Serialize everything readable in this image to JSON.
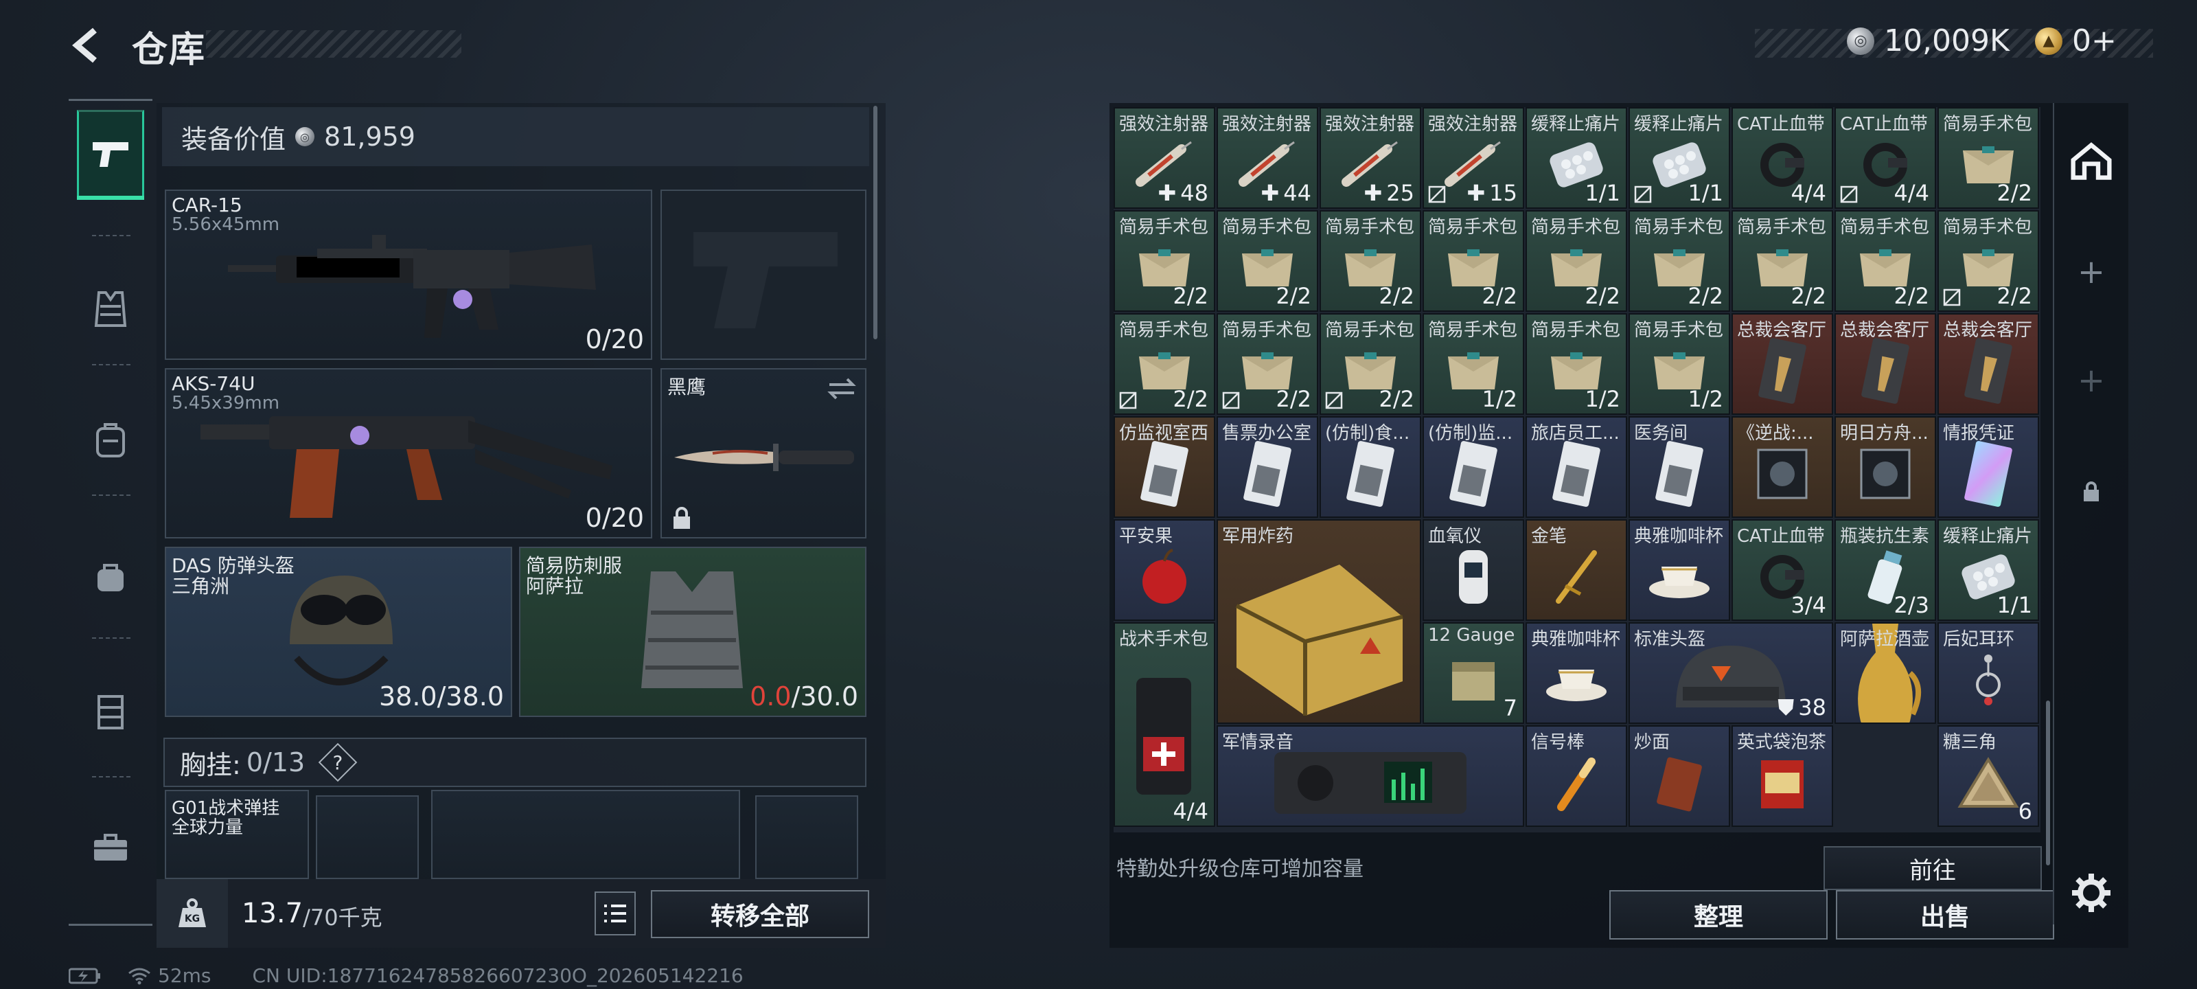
{
  "header": {
    "title": "仓库"
  },
  "currencies": [
    {
      "icon": "silver-coin-icon",
      "amount": "10,009K"
    },
    {
      "icon": "gold-coin-icon",
      "amount": "0+"
    }
  ],
  "nav": {
    "items": [
      {
        "name": "weapons",
        "icon": "pistol-icon",
        "active": true
      },
      {
        "name": "armor",
        "icon": "vest-icon"
      },
      {
        "name": "backpack",
        "icon": "backpack-icon"
      },
      {
        "name": "pouch",
        "icon": "pouch-icon"
      },
      {
        "name": "chest-rig",
        "icon": "rig-icon"
      },
      {
        "name": "case",
        "icon": "case-icon"
      }
    ]
  },
  "loadout": {
    "equip_value_label": "装备价值",
    "equip_value": "81,959",
    "primary1": {
      "name": "CAR-15",
      "caliber": "5.56x45mm",
      "ammo": "0/20"
    },
    "primary2": {
      "name": "AKS-74U",
      "caliber": "5.45x39mm",
      "ammo": "0/20"
    },
    "melee": {
      "name": "黑鹰"
    },
    "helmet": {
      "name": "DAS 防弹头盔",
      "sub": "三角洲",
      "dur": "38.0/38.0"
    },
    "armor": {
      "name": "简易防刺服",
      "sub": "阿萨拉",
      "dur_cur": "0.0",
      "dur_max": "/30.0"
    },
    "chest": {
      "label": "胸挂:",
      "count": "0/13",
      "help": "?"
    },
    "rig": {
      "name": "G01战术弹挂",
      "sub": "全球力量"
    },
    "weight": "13.7",
    "weight_max": "/70千克",
    "transfer_all": "转移全部"
  },
  "inventory": {
    "hint": "特勤处升级仓库可增加容量",
    "goto": "前往",
    "sort": "整理",
    "sell": "出售",
    "items": [
      {
        "label": "强效注射器",
        "qty": "48",
        "plus": true,
        "color": "green",
        "art": "syringe"
      },
      {
        "label": "强效注射器",
        "qty": "44",
        "plus": true,
        "color": "green",
        "art": "syringe"
      },
      {
        "label": "强效注射器",
        "qty": "25",
        "plus": true,
        "color": "green",
        "art": "syringe"
      },
      {
        "label": "强效注射器",
        "qty": "15",
        "plus": true,
        "lock": true,
        "color": "green",
        "art": "syringe"
      },
      {
        "label": "缓释止痛片",
        "qty": "1/1",
        "color": "green",
        "art": "pills"
      },
      {
        "label": "缓释止痛片",
        "qty": "1/1",
        "lock": true,
        "color": "green",
        "art": "pills"
      },
      {
        "label": "CAT止血带",
        "qty": "4/4",
        "color": "green",
        "art": "tourniquet"
      },
      {
        "label": "CAT止血带",
        "qty": "4/4",
        "lock": true,
        "color": "green",
        "art": "tourniquet"
      },
      {
        "label": "简易手术包",
        "qty": "2/2",
        "color": "green",
        "art": "kit"
      },
      {
        "label": "简易手术包",
        "qty": "2/2",
        "color": "green",
        "art": "kit"
      },
      {
        "label": "简易手术包",
        "qty": "2/2",
        "color": "green",
        "art": "kit"
      },
      {
        "label": "简易手术包",
        "qty": "2/2",
        "color": "green",
        "art": "kit"
      },
      {
        "label": "简易手术包",
        "qty": "2/2",
        "color": "green",
        "art": "kit"
      },
      {
        "label": "简易手术包",
        "qty": "2/2",
        "color": "green",
        "art": "kit"
      },
      {
        "label": "简易手术包",
        "qty": "2/2",
        "color": "green",
        "art": "kit"
      },
      {
        "label": "简易手术包",
        "qty": "2/2",
        "color": "green",
        "art": "kit"
      },
      {
        "label": "简易手术包",
        "qty": "2/2",
        "color": "green",
        "art": "kit"
      },
      {
        "label": "简易手术包",
        "qty": "2/2",
        "lock": true,
        "color": "green",
        "art": "kit"
      },
      {
        "label": "简易手术包",
        "qty": "2/2",
        "lock": true,
        "color": "green",
        "art": "kit"
      },
      {
        "label": "简易手术包",
        "qty": "2/2",
        "lock": true,
        "color": "green",
        "art": "kit"
      },
      {
        "label": "简易手术包",
        "qty": "2/2",
        "lock": true,
        "color": "green",
        "art": "kit"
      },
      {
        "label": "简易手术包",
        "qty": "1/2",
        "color": "green",
        "art": "kit"
      },
      {
        "label": "简易手术包",
        "qty": "1/2",
        "color": "green",
        "art": "kit"
      },
      {
        "label": "简易手术包",
        "qty": "1/2",
        "color": "green",
        "art": "kit"
      },
      {
        "label": "总裁会客厅",
        "color": "red",
        "art": "card-gold"
      },
      {
        "label": "总裁会客厅",
        "color": "red",
        "art": "card-gold"
      },
      {
        "label": "总裁会客厅",
        "color": "red",
        "art": "card-gold"
      },
      {
        "label": "仿监视室西",
        "color": "brown",
        "art": "card"
      },
      {
        "label": "售票办公室",
        "color": "blue",
        "art": "card"
      },
      {
        "label": "(仿制)食...",
        "color": "blue",
        "art": "card"
      },
      {
        "label": "(仿制)监...",
        "color": "blue",
        "art": "card"
      },
      {
        "label": "旅店员工...",
        "color": "blue",
        "art": "card"
      },
      {
        "label": "医务间",
        "color": "blue",
        "art": "card"
      },
      {
        "label": "《逆战:...",
        "color": "brown",
        "art": "disc"
      },
      {
        "label": "明日方舟...",
        "color": "brown",
        "art": "disc"
      },
      {
        "label": "情报凭证",
        "color": "blue",
        "art": "holo"
      },
      {
        "label": "平安果",
        "color": "blue",
        "art": "apple"
      },
      {
        "label": "血氧仪",
        "color": "dark",
        "art": "oximeter"
      },
      {
        "label": "金笔",
        "color": "brown",
        "art": "pen"
      },
      {
        "label": "典雅咖啡杯",
        "color": "blue",
        "art": "cup"
      },
      {
        "label": "CAT止血带",
        "qty": "3/4",
        "color": "green",
        "art": "tourniquet"
      },
      {
        "label": "瓶装抗生素",
        "qty": "2/3",
        "color": "green",
        "art": "bottle"
      },
      {
        "label": "缓释止痛片",
        "qty": "1/1",
        "color": "green",
        "art": "pills"
      },
      {
        "label": "12 Gauge",
        "qty": "7",
        "color": "green",
        "art": "ammo"
      },
      {
        "label": "典雅咖啡杯",
        "color": "blue",
        "art": "cup"
      },
      {
        "label": "阿萨拉酒壶",
        "color": "blue",
        "art": "jug"
      },
      {
        "label": "后妃耳环",
        "color": "blue",
        "art": "earring"
      },
      {
        "label": "信号棒",
        "color": "blue",
        "art": "flare"
      },
      {
        "label": "炒面",
        "color": "blue",
        "art": "noodle"
      },
      {
        "label": "英式袋泡茶",
        "color": "blue",
        "art": "tea"
      },
      {
        "label": "糖三角",
        "qty": "6",
        "color": "blue",
        "art": "triangle"
      }
    ],
    "big_items": [
      {
        "label": "军用炸药",
        "color": "brown",
        "art": "explosive"
      },
      {
        "label": "战术手术包",
        "qty": "4/4",
        "color": "green",
        "art": "medbag"
      },
      {
        "label": "标准头盔",
        "qty": "38",
        "shield": true,
        "color": "blue",
        "art": "helmet"
      },
      {
        "label": "军情录音",
        "color": "blue",
        "art": "recorder"
      }
    ]
  },
  "status": {
    "ping": "52ms",
    "uid": "CN UID:18771624785826607230O_202605142216"
  },
  "colors": {
    "accent": "#39e0a8",
    "panel": "#1e2530",
    "danger": "#e0433a"
  }
}
